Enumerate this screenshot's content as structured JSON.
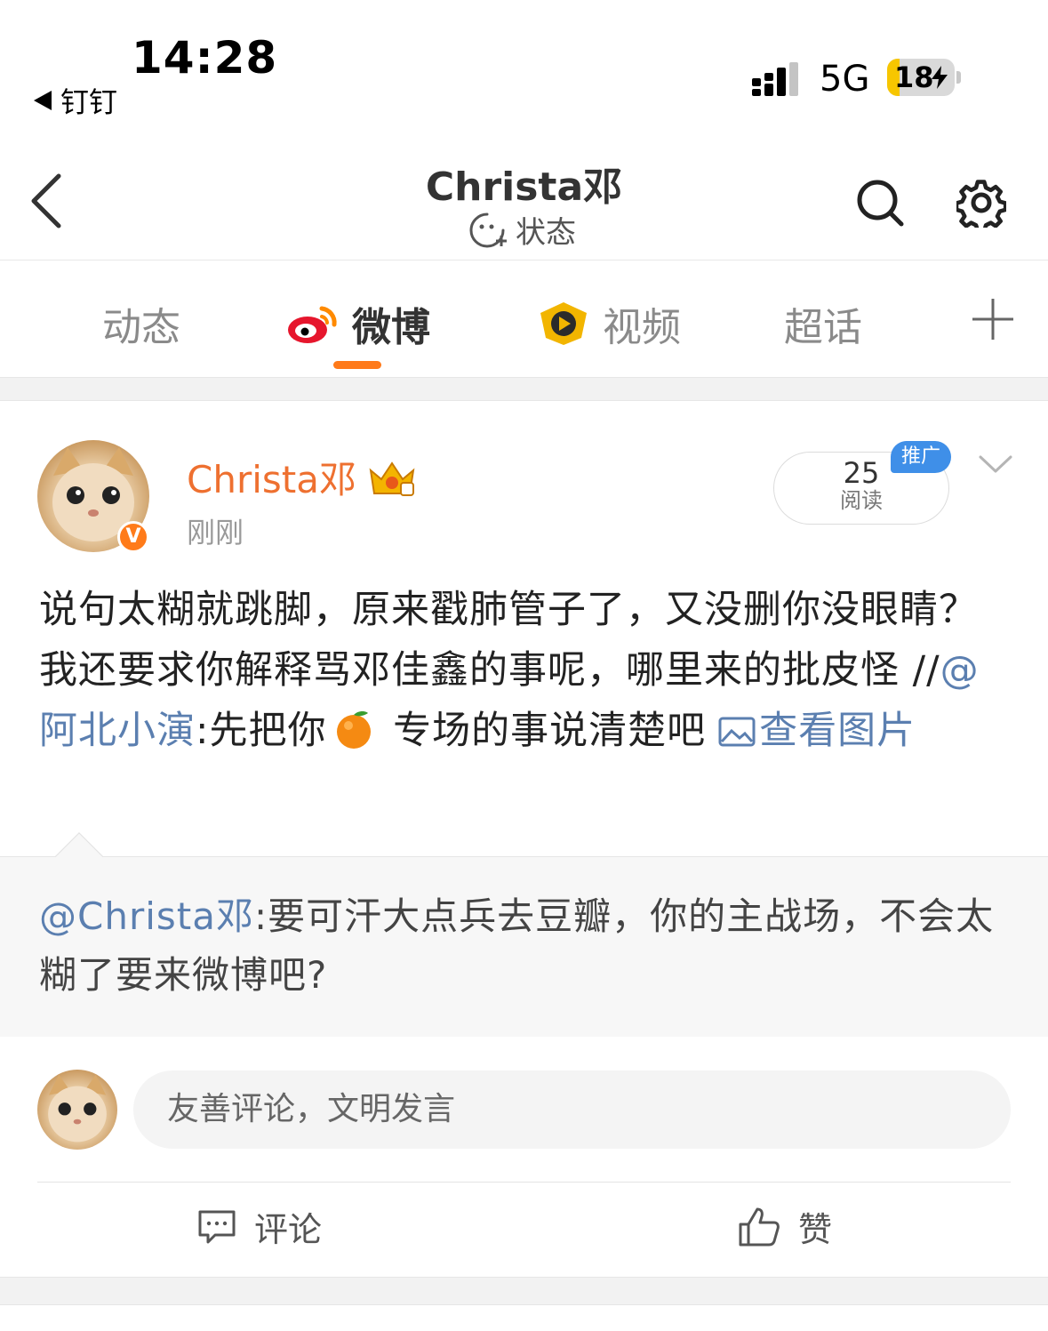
{
  "status_bar": {
    "time": "14:28",
    "back_app": "钉钉",
    "network": "5G",
    "battery_level": "18",
    "battery_fraction": 0.18
  },
  "header": {
    "title": "Christa邓",
    "status_label": "状态",
    "icons": [
      "back-chevron-icon",
      "status-face-icon",
      "search-icon",
      "gear-icon"
    ]
  },
  "tabs": [
    {
      "label": "动态",
      "active": false
    },
    {
      "label": "微博",
      "active": true,
      "icon": "weibo-logo-icon"
    },
    {
      "label": "视频",
      "active": false,
      "icon": "video-play-icon"
    },
    {
      "label": "超话",
      "active": false
    }
  ],
  "post": {
    "author": "Christa邓",
    "verified_badge": "V",
    "time": "刚刚",
    "read_count": "25",
    "read_label": "阅读",
    "promo_badge": "推广",
    "text_part1": "说句太糊就跳脚，原来戳肺管子了，又没删你没眼睛？我还要求你解释骂邓佳鑫的事呢，哪里来的批皮怪 //",
    "mention": "@阿北小演",
    "text_part2": ":先把你",
    "text_part3": " 专场的事说清楚吧",
    "view_image": "查看图片",
    "quoted_mention": "@Christa邓",
    "quoted_text": ":要可汗大点兵去豆瓣，你的主战场，不会太糊了要来微博吧?"
  },
  "comment": {
    "placeholder": "友善评论，文明发言"
  },
  "actions": {
    "comment_label": "评论",
    "like_label": "赞"
  },
  "colors": {
    "accent": "#ff7a1a",
    "author": "#ee7030",
    "link": "#5b7fb0",
    "promo": "#3f8fe8"
  }
}
